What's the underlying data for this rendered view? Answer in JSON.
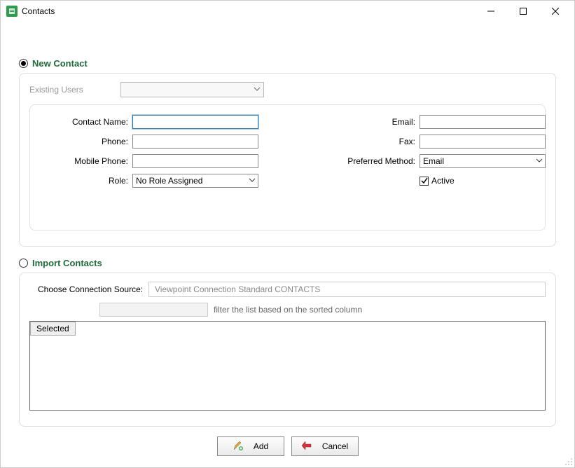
{
  "window": {
    "title": "Contacts"
  },
  "sections": {
    "new_contact_label": "New Contact",
    "import_contacts_label": "Import Contacts"
  },
  "new_contact": {
    "existing_users_label": "Existing Users",
    "existing_users_value": "",
    "fields": {
      "contact_name_label": "Contact Name:",
      "contact_name_value": "",
      "phone_label": "Phone:",
      "phone_value": "",
      "mobile_phone_label": "Mobile Phone:",
      "mobile_phone_value": "",
      "role_label": "Role:",
      "role_value": "No Role Assigned",
      "email_label": "Email:",
      "email_value": "",
      "fax_label": "Fax:",
      "fax_value": "",
      "preferred_method_label": "Preferred Method:",
      "preferred_method_value": "Email",
      "active_label": "Active",
      "active_checked": true
    }
  },
  "import": {
    "source_label": "Choose Connection Source:",
    "source_value": "Viewpoint Connection Standard CONTACTS",
    "filter_value": "",
    "filter_hint": "filter the list based on the sorted column",
    "grid_columns": [
      "Selected"
    ]
  },
  "buttons": {
    "add": "Add",
    "cancel": "Cancel"
  }
}
